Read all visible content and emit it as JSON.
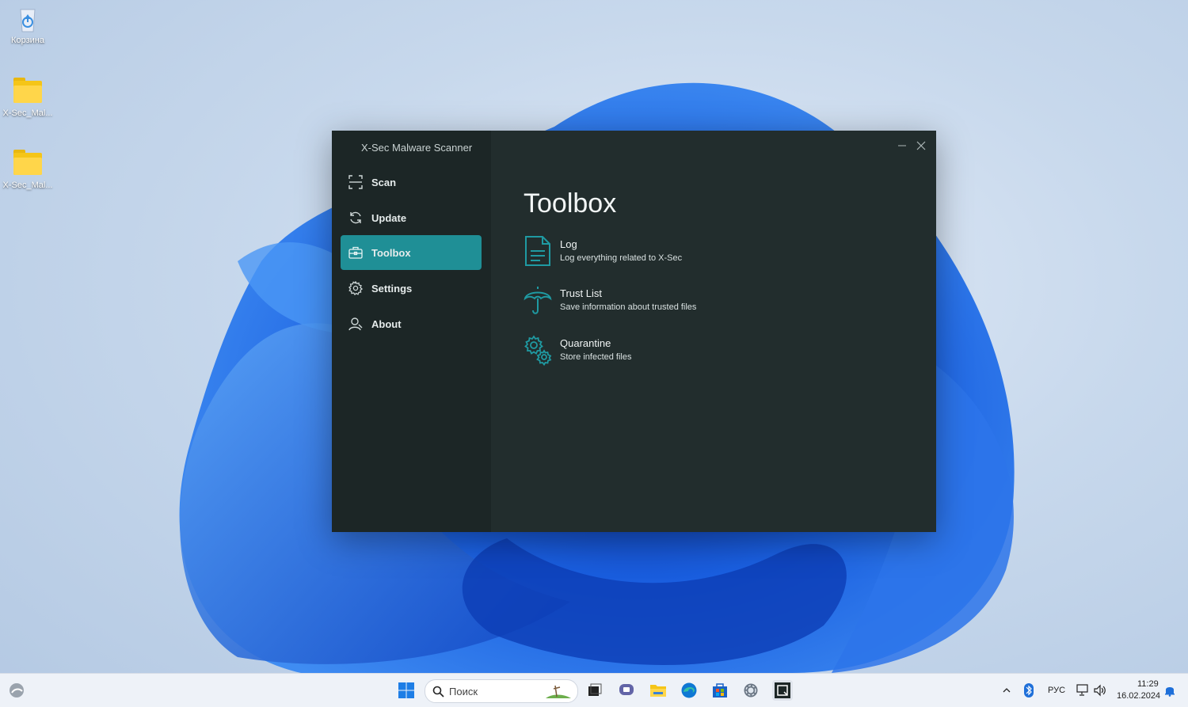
{
  "desktop": {
    "icons": [
      {
        "label": "Корзина",
        "icon": "recycle-bin-icon"
      },
      {
        "label": "X-Sec_Mal...",
        "icon": "folder-icon"
      },
      {
        "label": "X-Sec_Mal...",
        "icon": "folder-icon"
      }
    ]
  },
  "app": {
    "title": "X-Sec Malware Scanner",
    "accent": "#1f8f96",
    "nav": [
      {
        "label": "Scan",
        "icon": "scan-icon",
        "active": false
      },
      {
        "label": "Update",
        "icon": "refresh-icon",
        "active": false
      },
      {
        "label": "Toolbox",
        "icon": "toolbox-icon",
        "active": true
      },
      {
        "label": "Settings",
        "icon": "gear-icon",
        "active": false
      },
      {
        "label": "About",
        "icon": "person-icon",
        "active": false
      }
    ],
    "page_title": "Toolbox",
    "tools": [
      {
        "name": "Log",
        "description": "Log everything related to X-Sec",
        "icon": "document-icon"
      },
      {
        "name": "Trust List",
        "description": "Save information about trusted files",
        "icon": "umbrella-icon"
      },
      {
        "name": "Quarantine",
        "description": "Store infected files",
        "icon": "gears-icon"
      }
    ]
  },
  "taskbar": {
    "search_placeholder": "Поиск",
    "language": "РУС",
    "time": "11:29",
    "date": "16.02.2024"
  }
}
